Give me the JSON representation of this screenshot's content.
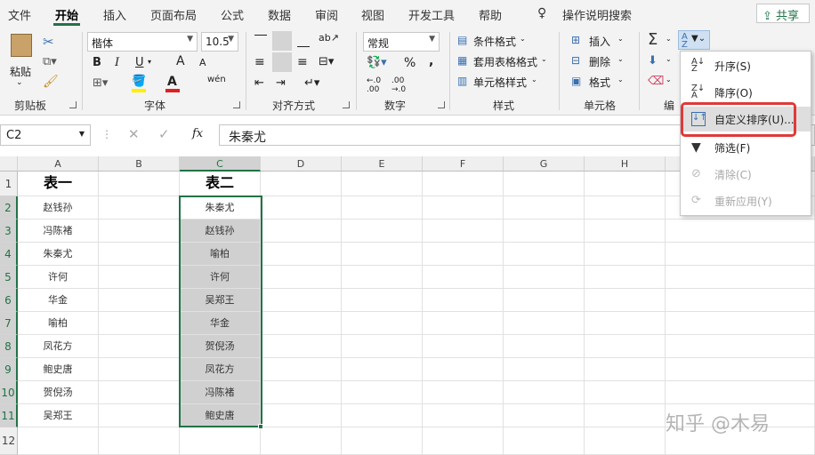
{
  "tabs": [
    "文件",
    "开始",
    "插入",
    "页面布局",
    "公式",
    "数据",
    "审阅",
    "视图",
    "开发工具",
    "帮助"
  ],
  "tell_me": "操作说明搜索",
  "share": "共享",
  "clipboard": {
    "paste": "粘贴",
    "group": "剪贴板"
  },
  "font": {
    "name": "楷体",
    "size": "10.5",
    "group": "字体",
    "bold": "B",
    "italic": "I",
    "underline": "U",
    "grow": "A",
    "shrink": "A",
    "phonetic": "wén"
  },
  "alignment": {
    "group": "对齐方式"
  },
  "number": {
    "format": "常规",
    "group": "数字",
    "percent": "%",
    "comma": ","
  },
  "styles": {
    "conditional": "条件格式",
    "table": "套用表格格式",
    "cell": "单元格样式",
    "group": "样式"
  },
  "cells": {
    "insert": "插入",
    "delete": "删除",
    "format": "格式",
    "group": "单元格"
  },
  "editing": {
    "group": "编"
  },
  "name_box": "C2",
  "formula_value": "朱秦尤",
  "fx": "fx",
  "columns": [
    "A",
    "B",
    "C",
    "D",
    "E",
    "F",
    "G",
    "H"
  ],
  "rows": [
    "1",
    "2",
    "3",
    "4",
    "5",
    "6",
    "7",
    "8",
    "9",
    "10",
    "11",
    "12"
  ],
  "col_a": [
    "表一",
    "赵钱孙",
    "冯陈褚",
    "朱秦尤",
    "许何",
    "华金",
    "喻柏",
    "凤花方",
    "鲍史唐",
    "贺倪汤",
    "吴郑王"
  ],
  "col_c": [
    "表二",
    "朱秦尤",
    "赵钱孙",
    "喻柏",
    "许何",
    "吴郑王",
    "华金",
    "贺倪汤",
    "凤花方",
    "冯陈褚",
    "鲍史唐"
  ],
  "sort_menu": {
    "asc": "升序(S)",
    "desc": "降序(O)",
    "custom": "自定义排序(U)...",
    "filter": "筛选(F)",
    "clear": "清除(C)",
    "reapply": "重新应用(Y)"
  },
  "watermark": "知乎 @木易",
  "colors": {
    "accent": "#217346",
    "highlight": "#e0393a",
    "font_color": "#e02020",
    "fill": "#ffee00"
  }
}
